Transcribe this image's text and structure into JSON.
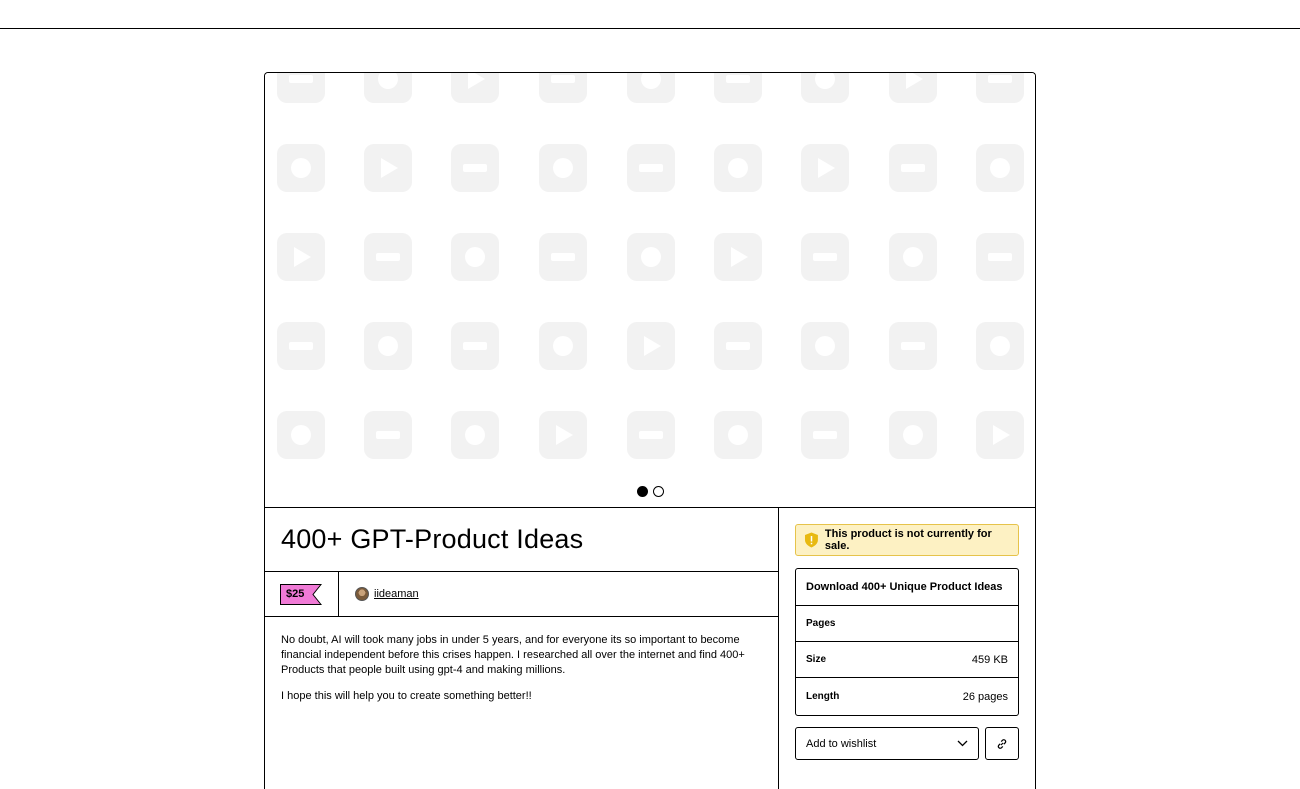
{
  "product": {
    "title": "400+ GPT-Product Ideas",
    "price": "$25",
    "creator": "iideaman",
    "description": [
      "No doubt, AI will took many jobs in under 5 years, and for everyone its so important to become financial independent before this crises happen. I researched all over the internet and find 400+ Products that people built using gpt-4 and making millions.",
      "I hope this will help you to create something better!!"
    ]
  },
  "carousel": {
    "slides": 2,
    "active": 0
  },
  "sidebar": {
    "notice": "This product is not currently for sale.",
    "download_label": "Download 400+ Unique Product Ideas",
    "details": [
      {
        "key": "Pages",
        "value": ""
      },
      {
        "key": "Size",
        "value": "459 KB"
      },
      {
        "key": "Length",
        "value": "26 pages"
      }
    ],
    "wishlist_label": "Add to wishlist"
  },
  "colors": {
    "price_tag": "#f07ad6",
    "alert_bg": "#fdf1c3",
    "alert_icon": "#e8b911",
    "cover_icon": "#f2f2f2"
  }
}
